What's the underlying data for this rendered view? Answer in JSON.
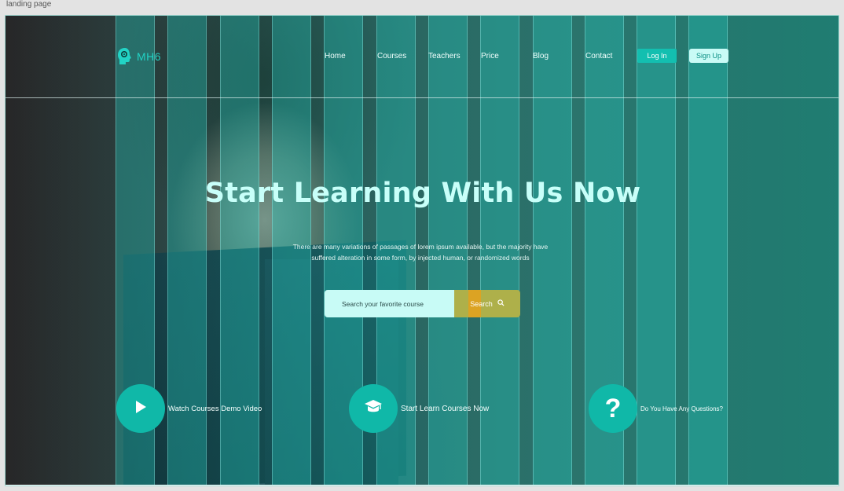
{
  "window": {
    "tab_label": "landing page"
  },
  "brand": {
    "name": "MH6",
    "accent": "#13bfb0",
    "heading_color": "#c8fff9"
  },
  "nav": {
    "items": [
      {
        "label": "Home"
      },
      {
        "label": "Courses"
      },
      {
        "label": "Teachers"
      },
      {
        "label": "Price"
      },
      {
        "label": "Blog"
      },
      {
        "label": "Contact"
      }
    ],
    "login_label": "Log In",
    "signup_label": "Sign Up"
  },
  "hero": {
    "title": "Start Learning With Us Now",
    "subtitle": "There are many variations of passages of lorem ipsum available, but the majority have suffered alteration in some form, by injected human, or randomized words",
    "search": {
      "placeholder": "Search your favorite course",
      "button_label": "Search"
    }
  },
  "features": [
    {
      "icon": "play-icon",
      "label": "Watch Courses Demo Video"
    },
    {
      "icon": "graduation-cap-icon",
      "label": "Start Learn Courses Now"
    },
    {
      "icon": "question-mark-icon",
      "label": "Do You Have Any Questions?"
    }
  ]
}
